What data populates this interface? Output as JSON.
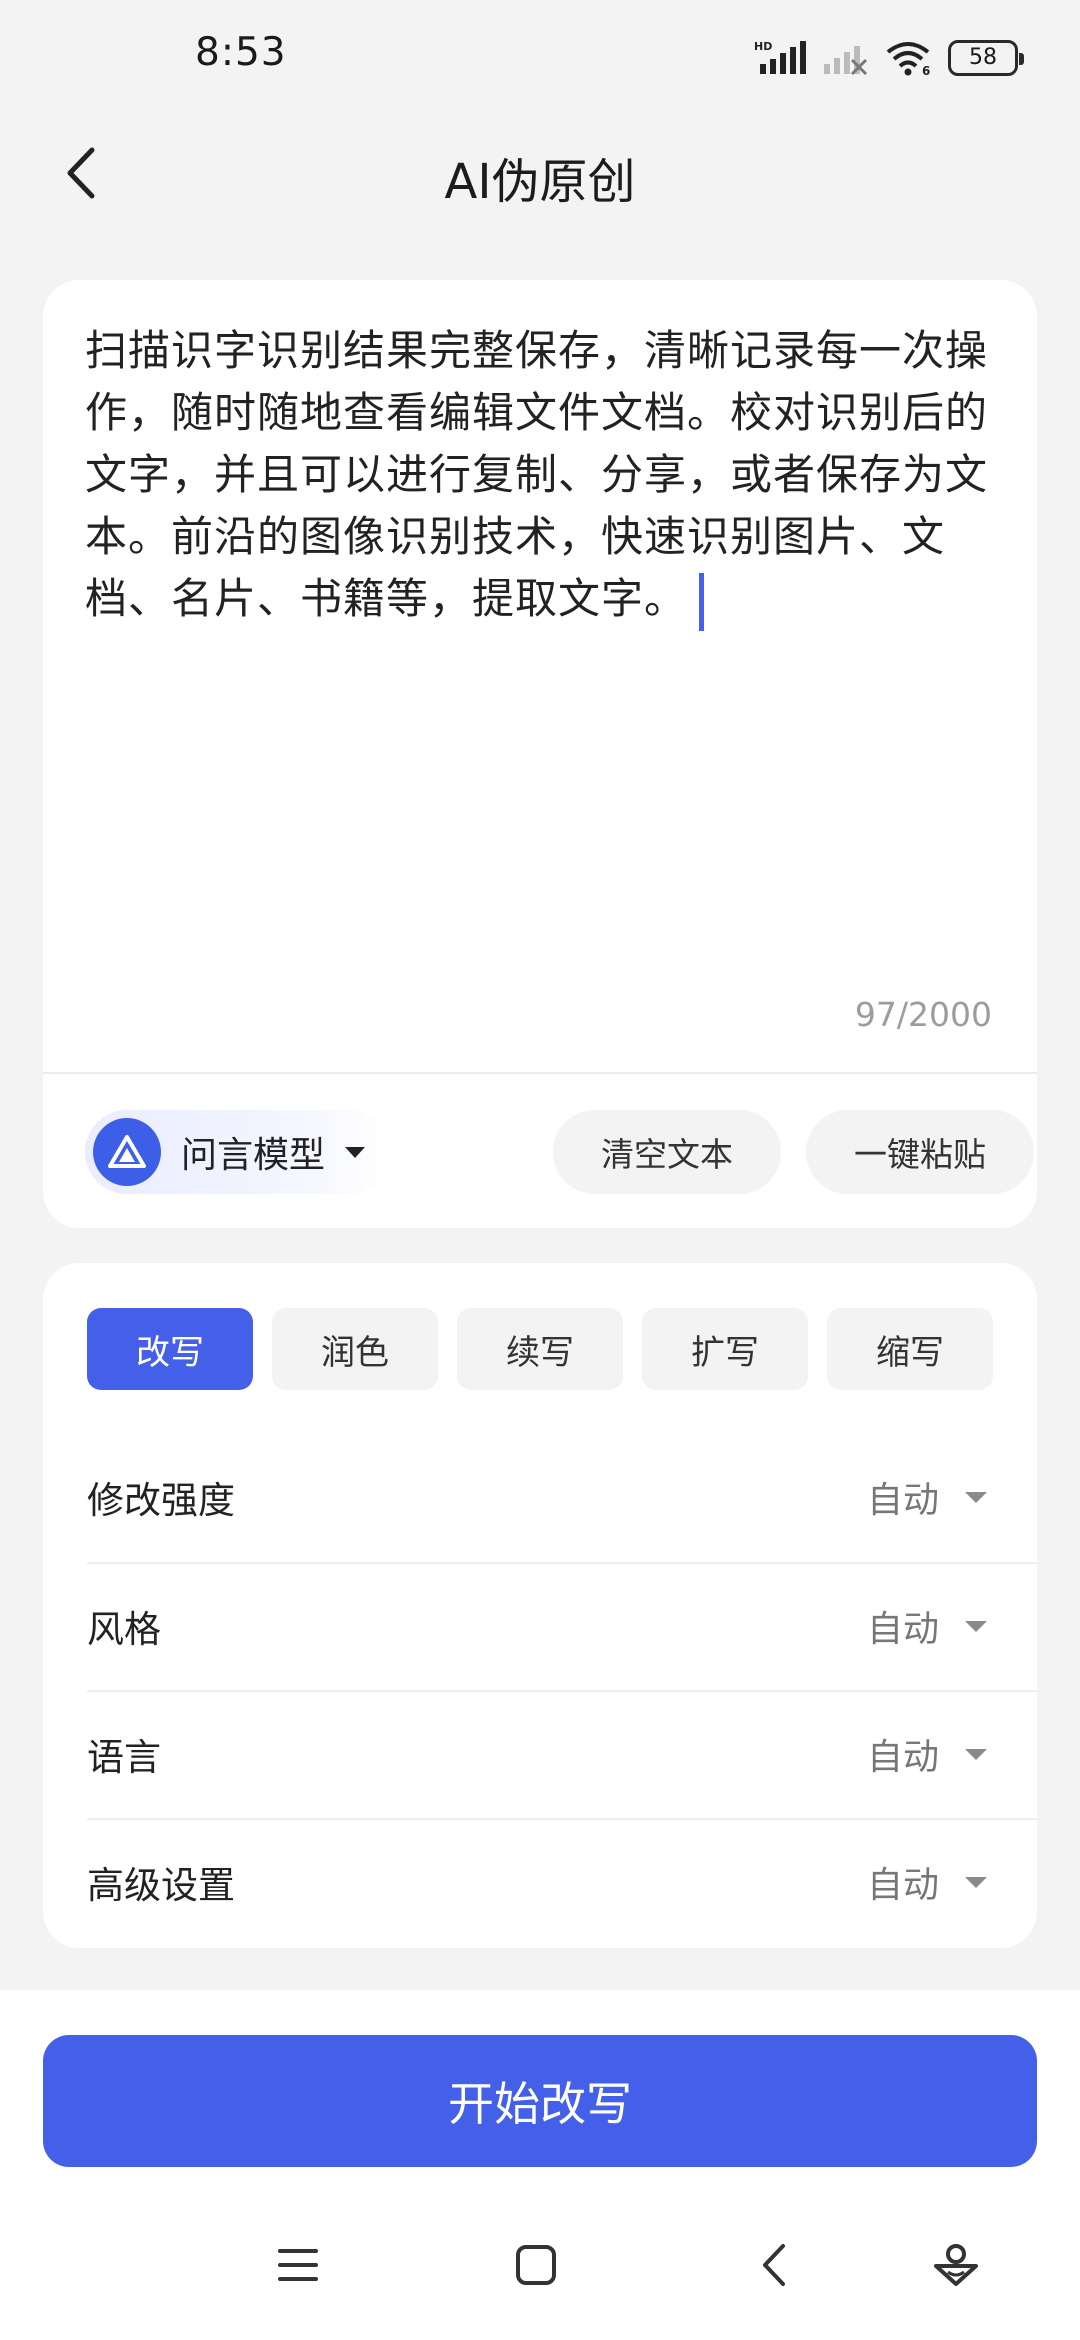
{
  "status_bar": {
    "time": "8:53",
    "hd_label": "HD",
    "battery": "58"
  },
  "header": {
    "title": "AI伪原创",
    "back_icon": "chevron-left-icon"
  },
  "editor": {
    "text": "扫描识字识别结果完整保存，清晰记录每一次操作，随时随地查看编辑文件文档。校对识别后的文字，并且可以进行复制、分享，或者保存为文本。前沿的图像识别技术，快速识别图片、文档、名片、书籍等，提取文字。",
    "char_count": "97/2000",
    "model_label": "问言模型",
    "clear_label": "清空文本",
    "paste_label": "一键粘贴"
  },
  "modes": {
    "tabs": [
      {
        "label": "改写",
        "active": true
      },
      {
        "label": "润色",
        "active": false
      },
      {
        "label": "续写",
        "active": false
      },
      {
        "label": "扩写",
        "active": false
      },
      {
        "label": "缩写",
        "active": false
      }
    ]
  },
  "options": [
    {
      "label": "修改强度",
      "value": "自动"
    },
    {
      "label": "风格",
      "value": "自动"
    },
    {
      "label": "语言",
      "value": "自动"
    },
    {
      "label": "高级设置",
      "value": "自动"
    }
  ],
  "action": {
    "start_label": "开始改写"
  },
  "colors": {
    "accent": "#4560e8",
    "background": "#f3f3f3",
    "card": "#ffffff"
  }
}
